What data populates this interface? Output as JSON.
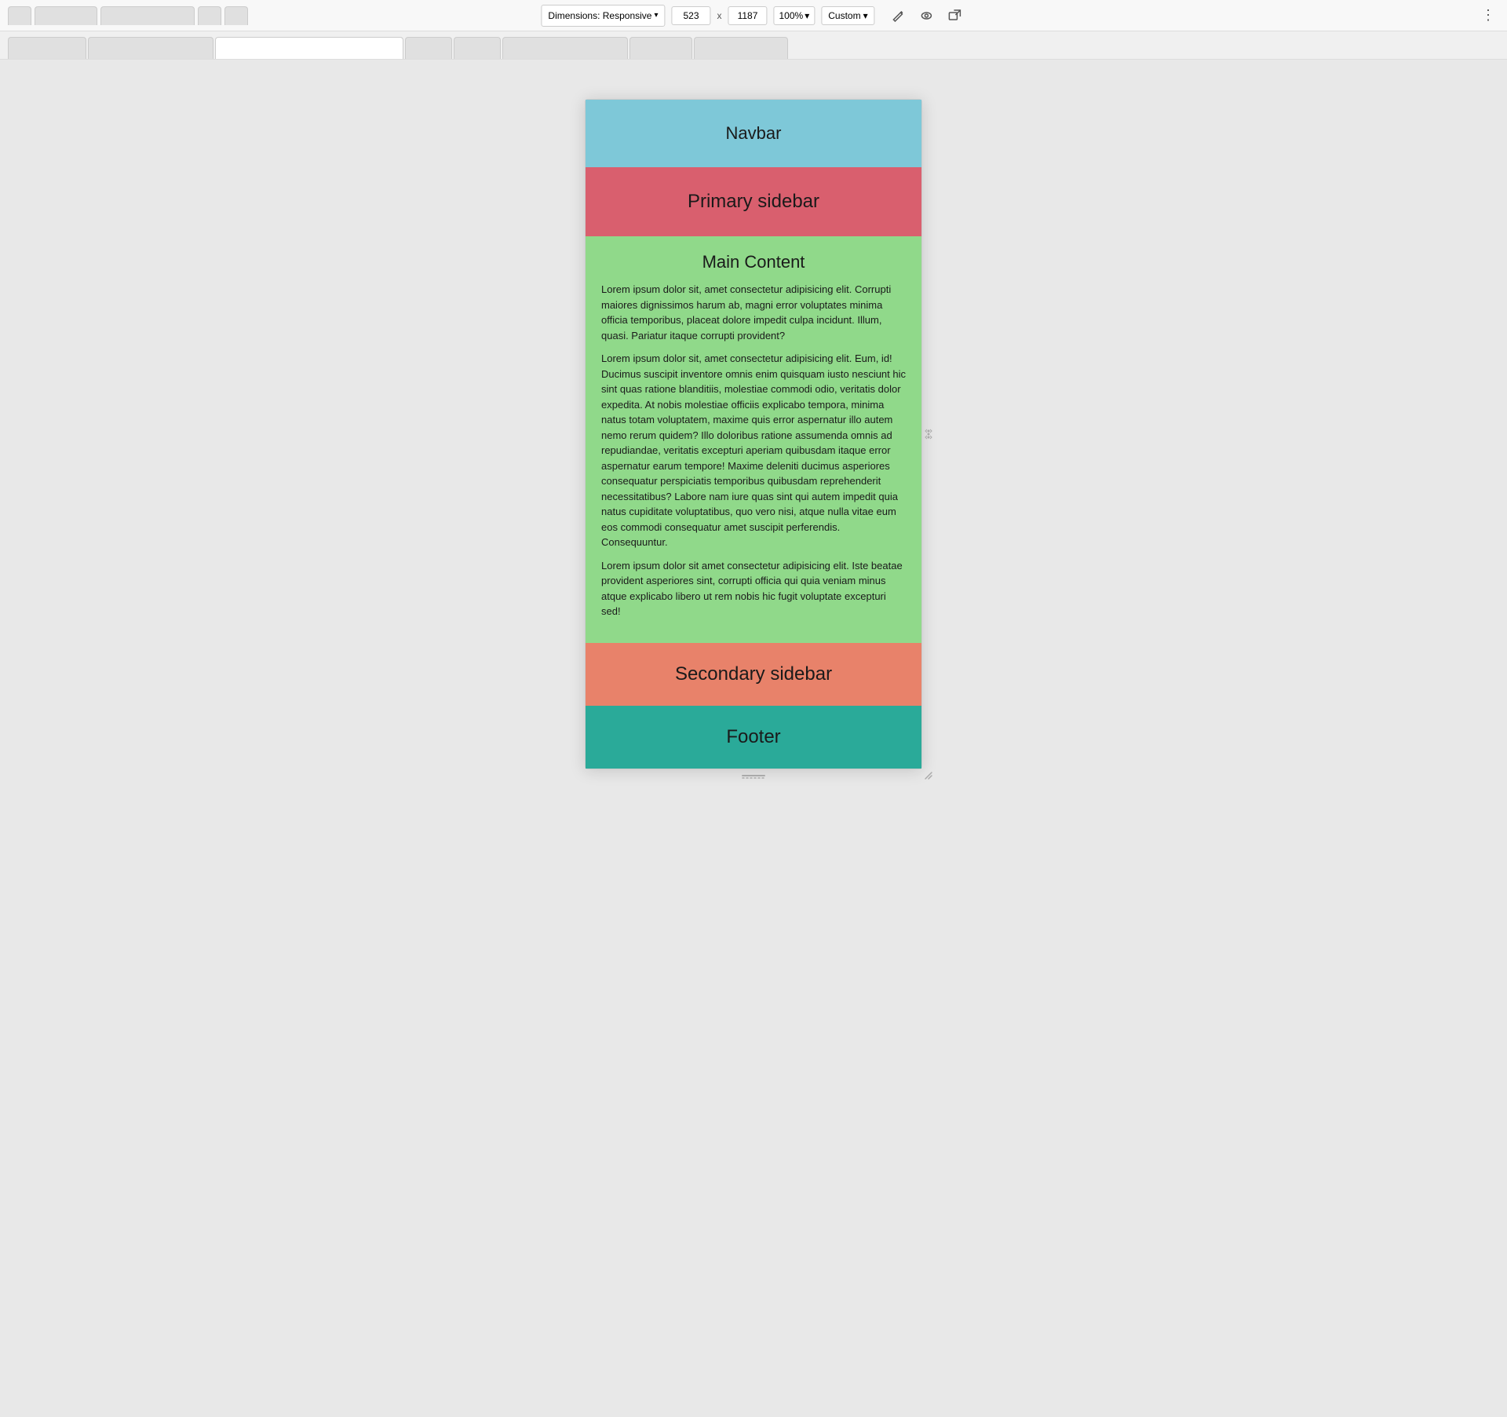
{
  "toolbar": {
    "dimensions_label": "Dimensions: Responsive",
    "width_value": "523",
    "height_value": "1187",
    "zoom_label": "100%",
    "custom_label": "Custom",
    "chevron": "▾"
  },
  "tabs": [
    {
      "label": "",
      "active": false
    },
    {
      "label": "",
      "active": false
    },
    {
      "label": "",
      "active": true
    },
    {
      "label": "",
      "active": false
    },
    {
      "label": "",
      "active": false
    },
    {
      "label": "",
      "active": false
    },
    {
      "label": "",
      "active": false
    },
    {
      "label": "",
      "active": false
    }
  ],
  "sections": {
    "navbar": {
      "title": "Navbar",
      "bg": "#7ec8d8"
    },
    "primary_sidebar": {
      "title": "Primary sidebar",
      "bg": "#d95f6e"
    },
    "main_content": {
      "title": "Main Content",
      "bg": "#90d98a",
      "paragraphs": [
        "Lorem ipsum dolor sit, amet consectetur adipisicing elit. Corrupti maiores dignissimos harum ab, magni error voluptates minima officia temporibus, placeat dolore impedit culpa incidunt. Illum, quasi. Pariatur itaque corrupti provident?",
        "Lorem ipsum dolor sit, amet consectetur adipisicing elit. Eum, id! Ducimus suscipit inventore omnis enim quisquam iusto nesciunt hic sint quas ratione blanditiis, molestiae commodi odio, veritatis dolor expedita. At nobis molestiae officiis explicabo tempora, minima natus totam voluptatem, maxime quis error aspernatur illo autem nemo rerum quidem? Illo doloribus ratione assumenda omnis ad repudiandae, veritatis excepturi aperiam quibusdam itaque error aspernatur earum tempore! Maxime deleniti ducimus asperiores consequatur perspiciatis temporibus quibusdam reprehenderit necessitatibus? Labore nam iure quas sint qui autem impedit quia natus cupiditate voluptatibus, quo vero nisi, atque nulla vitae eum eos commodi consequatur amet suscipit perferendis. Consequuntur.",
        "Lorem ipsum dolor sit amet consectetur adipisicing elit. Iste beatae provident asperiores sint, corrupti officia qui quia veniam minus atque explicabo libero ut rem nobis hic fugit voluptate excepturi sed!"
      ]
    },
    "secondary_sidebar": {
      "title": "Secondary sidebar",
      "bg": "#e8826a"
    },
    "footer": {
      "title": "Footer",
      "bg": "#2aaa99"
    }
  }
}
